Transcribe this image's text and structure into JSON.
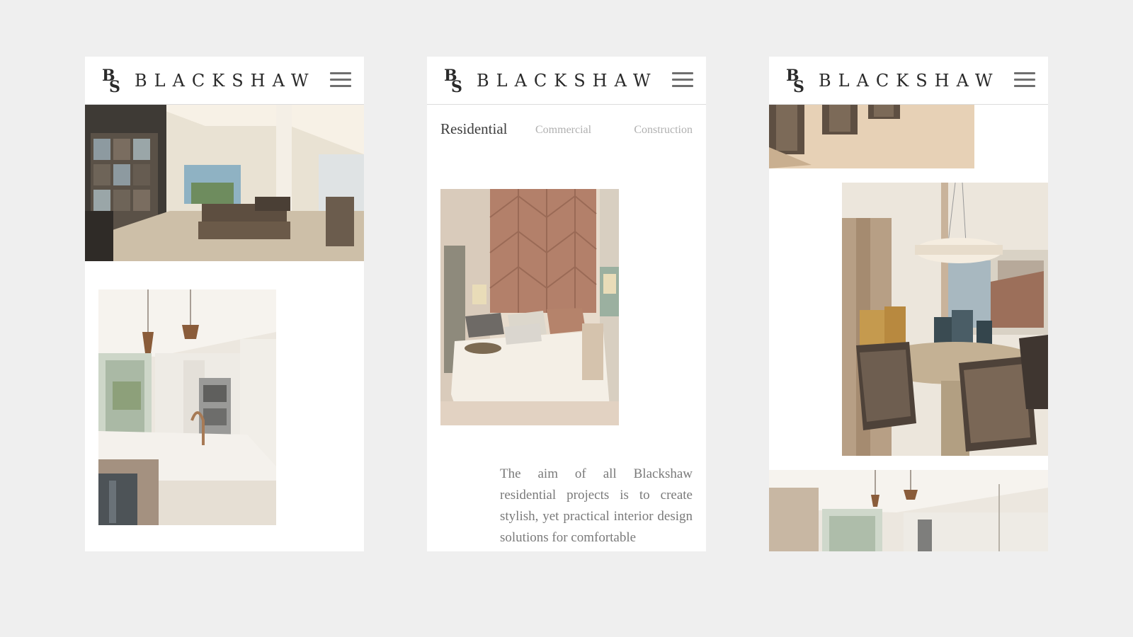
{
  "brand": {
    "name": "BLACKSHAW",
    "monogram": "BS"
  },
  "menu": {
    "icon": "hamburger-menu-icon"
  },
  "tabs": [
    {
      "label": "Residential",
      "active": true
    },
    {
      "label": "Commercial",
      "active": false
    },
    {
      "label": "Construction",
      "active": false
    }
  ],
  "residential": {
    "intro": "The aim of all Blackshaw residential projects is to create stylish, yet practical interior design solutions for comfortable"
  },
  "colors": {
    "background": "#efefef",
    "card": "#ffffff",
    "brand_text": "#2a2a2a",
    "tab_active": "#3d3d3d",
    "tab_inactive": "#b0b0b0",
    "body_text": "#7a7a7a",
    "menu_icon": "#6f6f6f"
  }
}
